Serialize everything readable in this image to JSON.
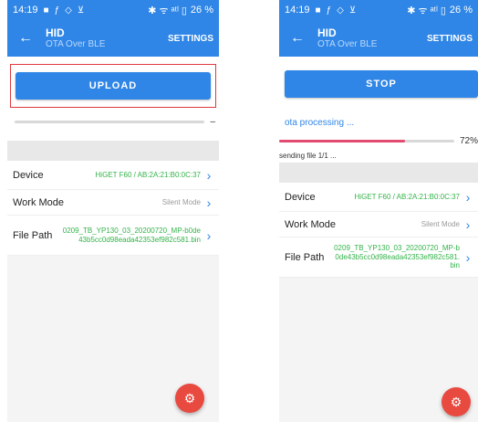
{
  "status_bar": {
    "time": "14:19",
    "battery": "26 %",
    "left_icons": [
      "■",
      "ƒ",
      "◇",
      "⊻"
    ],
    "right_icons": "✱ ᯤ ᵃᵗˡ ▯"
  },
  "appbar": {
    "title": "HID",
    "subtitle": "OTA Over BLE",
    "settings": "SETTINGS"
  },
  "screen1": {
    "button": "UPLOAD",
    "progress_pct": 0,
    "progress_label": "–"
  },
  "screen2": {
    "button": "STOP",
    "status": "ota processing ...",
    "progress_pct": 72,
    "progress_label": "72%",
    "sending": "sending file 1/1 ..."
  },
  "fields": {
    "device_label": "Device",
    "device_value": "HiGET F60 / AB:2A:21:B0:0C:37",
    "mode_label": "Work Mode",
    "mode_value": "Silent Mode",
    "path_label": "File Path",
    "path_value": "0209_TB_YP130_03_20200720_MP-b0de43b5cc0d98eada42353ef982c581.bin"
  },
  "colors": {
    "primary": "#2f86e6",
    "accent": "#e84a40",
    "green": "#34b34a",
    "progress": "#e24b6f"
  },
  "icons": {
    "back": "arrow-left-icon",
    "chevron": "chevron-right-icon",
    "fab": "gear-icon"
  }
}
